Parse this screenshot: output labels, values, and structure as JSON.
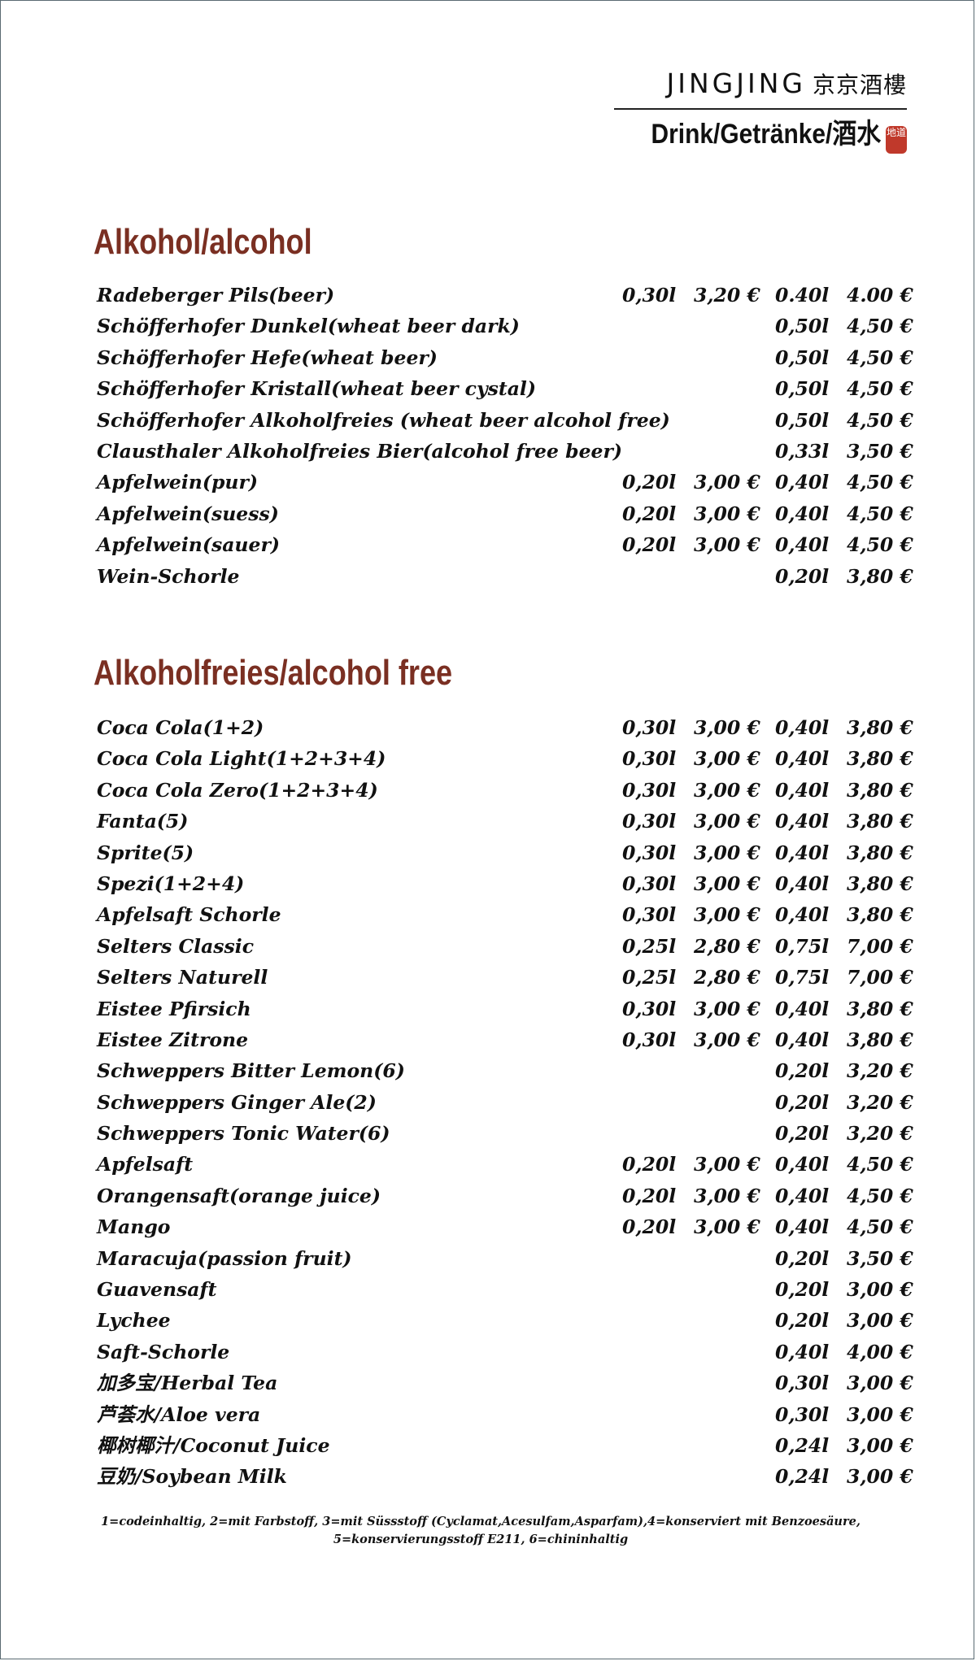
{
  "header": {
    "brand": "JINGJING",
    "brand_cn": "京京酒樓",
    "subtitle": "Drink/Getränke/酒水",
    "seal_text": "地道"
  },
  "sections": [
    {
      "title": "Alkohol/alcohol",
      "items": [
        {
          "name": "Radeberger Pils(beer)",
          "v1": "0,30l",
          "p1": "3,20 €",
          "v2": "0.40l",
          "p2": "4.00 €"
        },
        {
          "name": "Schöfferhofer Dunkel(wheat beer dark)",
          "v1": "",
          "p1": "",
          "v2": "0,50l",
          "p2": "4,50 €"
        },
        {
          "name": "Schöfferhofer Hefe(wheat beer)",
          "v1": "",
          "p1": "",
          "v2": "0,50l",
          "p2": "4,50 €"
        },
        {
          "name": "Schöfferhofer Kristall(wheat beer cystal)",
          "v1": "",
          "p1": "",
          "v2": "0,50l",
          "p2": "4,50 €"
        },
        {
          "name": "Schöfferhofer Alkoholfreies (wheat beer alcohol free)",
          "v1": "",
          "p1": "",
          "v2": "0,50l",
          "p2": "4,50 €"
        },
        {
          "name": "Clausthaler Alkoholfreies Bier(alcohol free beer)",
          "v1": "",
          "p1": "",
          "v2": "0,33l",
          "p2": "3,50 €"
        },
        {
          "name": "Apfelwein(pur)",
          "v1": "0,20l",
          "p1": "3,00 €",
          "v2": "0,40l",
          "p2": "4,50 €"
        },
        {
          "name": "Apfelwein(suess)",
          "v1": "0,20l",
          "p1": "3,00 €",
          "v2": "0,40l",
          "p2": "4,50 €"
        },
        {
          "name": "Apfelwein(sauer)",
          "v1": "0,20l",
          "p1": "3,00 €",
          "v2": "0,40l",
          "p2": "4,50 €"
        },
        {
          "name": "Wein-Schorle",
          "v1": "",
          "p1": "",
          "v2": "0,20l",
          "p2": "3,80 €"
        }
      ]
    },
    {
      "title": "Alkoholfreies/alcohol free",
      "items": [
        {
          "name": "Coca Cola(1+2)",
          "v1": "0,30l",
          "p1": "3,00 €",
          "v2": "0,40l",
          "p2": "3,80 €"
        },
        {
          "name": "Coca Cola Light(1+2+3+4)",
          "v1": "0,30l",
          "p1": "3,00 €",
          "v2": "0,40l",
          "p2": "3,80 €"
        },
        {
          "name": "Coca Cola Zero(1+2+3+4)",
          "v1": "0,30l",
          "p1": "3,00 €",
          "v2": "0,40l",
          "p2": "3,80 €"
        },
        {
          "name": "Fanta(5)",
          "v1": "0,30l",
          "p1": "3,00 €",
          "v2": "0,40l",
          "p2": "3,80 €"
        },
        {
          "name": "Sprite(5)",
          "v1": "0,30l",
          "p1": "3,00 €",
          "v2": "0,40l",
          "p2": "3,80 €"
        },
        {
          "name": "Spezi(1+2+4)",
          "v1": "0,30l",
          "p1": "3,00 €",
          "v2": "0,40l",
          "p2": "3,80 €"
        },
        {
          "name": "Apfelsaft Schorle",
          "v1": "0,30l",
          "p1": "3,00 €",
          "v2": "0,40l",
          "p2": "3,80 €"
        },
        {
          "name": "Selters Classic",
          "v1": "0,25l",
          "p1": "2,80 €",
          "v2": "0,75l",
          "p2": "7,00 €"
        },
        {
          "name": "Selters Naturell",
          "v1": "0,25l",
          "p1": "2,80 €",
          "v2": "0,75l",
          "p2": "7,00 €"
        },
        {
          "name": "Eistee Pfirsich",
          "v1": "0,30l",
          "p1": "3,00 €",
          "v2": "0,40l",
          "p2": "3,80 €"
        },
        {
          "name": "Eistee Zitrone",
          "v1": "0,30l",
          "p1": "3,00 €",
          "v2": "0,40l",
          "p2": "3,80 €"
        },
        {
          "name": "Schweppers Bitter Lemon(6)",
          "v1": "",
          "p1": "",
          "v2": "0,20l",
          "p2": "3,20 €"
        },
        {
          "name": "Schweppers Ginger Ale(2)",
          "v1": "",
          "p1": "",
          "v2": "0,20l",
          "p2": "3,20 €"
        },
        {
          "name": "Schweppers Tonic Water(6)",
          "v1": "",
          "p1": "",
          "v2": "0,20l",
          "p2": "3,20 €"
        },
        {
          "name": "Apfelsaft",
          "v1": "0,20l",
          "p1": "3,00 €",
          "v2": "0,40l",
          "p2": "4,50 €"
        },
        {
          "name": "Orangensaft(orange juice)",
          "v1": "0,20l",
          "p1": "3,00 €",
          "v2": "0,40l",
          "p2": "4,50 €"
        },
        {
          "name": "Mango",
          "v1": "0,20l",
          "p1": "3,00 €",
          "v2": "0,40l",
          "p2": "4,50 €"
        },
        {
          "name": "Maracuja(passion fruit)",
          "v1": "",
          "p1": "",
          "v2": "0,20l",
          "p2": "3,50 €"
        },
        {
          "name": "Guavensaft",
          "v1": "",
          "p1": "",
          "v2": "0,20l",
          "p2": "3,00 €"
        },
        {
          "name": "Lychee",
          "v1": "",
          "p1": "",
          "v2": "0,20l",
          "p2": "3,00 €"
        },
        {
          "name": "Saft-Schorle",
          "v1": "",
          "p1": "",
          "v2": "0,40l",
          "p2": "4,00 €"
        },
        {
          "name": "加多宝/Herbal Tea",
          "v1": "",
          "p1": "",
          "v2": "0,30l",
          "p2": "3,00 €"
        },
        {
          "name": "芦荟水/Aloe vera",
          "v1": "",
          "p1": "",
          "v2": "0,30l",
          "p2": "3,00 €"
        },
        {
          "name": "椰树椰汁/Coconut Juice",
          "v1": "",
          "p1": "",
          "v2": "0,24l",
          "p2": "3,00 €"
        },
        {
          "name": "豆奶/Soybean Milk",
          "v1": "",
          "p1": "",
          "v2": "0,24l",
          "p2": "3,00 €"
        }
      ]
    }
  ],
  "footnote": {
    "line1": "1=codeinhaltig, 2=mit Farbstoff, 3=mit Süssstoff (Cyclamat,Acesulfam,Asparfam),4=konserviert mit Benzoesäure,",
    "line2": "5=konservierungsstoff E211, 6=chininhaltig"
  },
  "colors": {
    "section_title": "#7a2f22",
    "seal": "#c0392b"
  }
}
